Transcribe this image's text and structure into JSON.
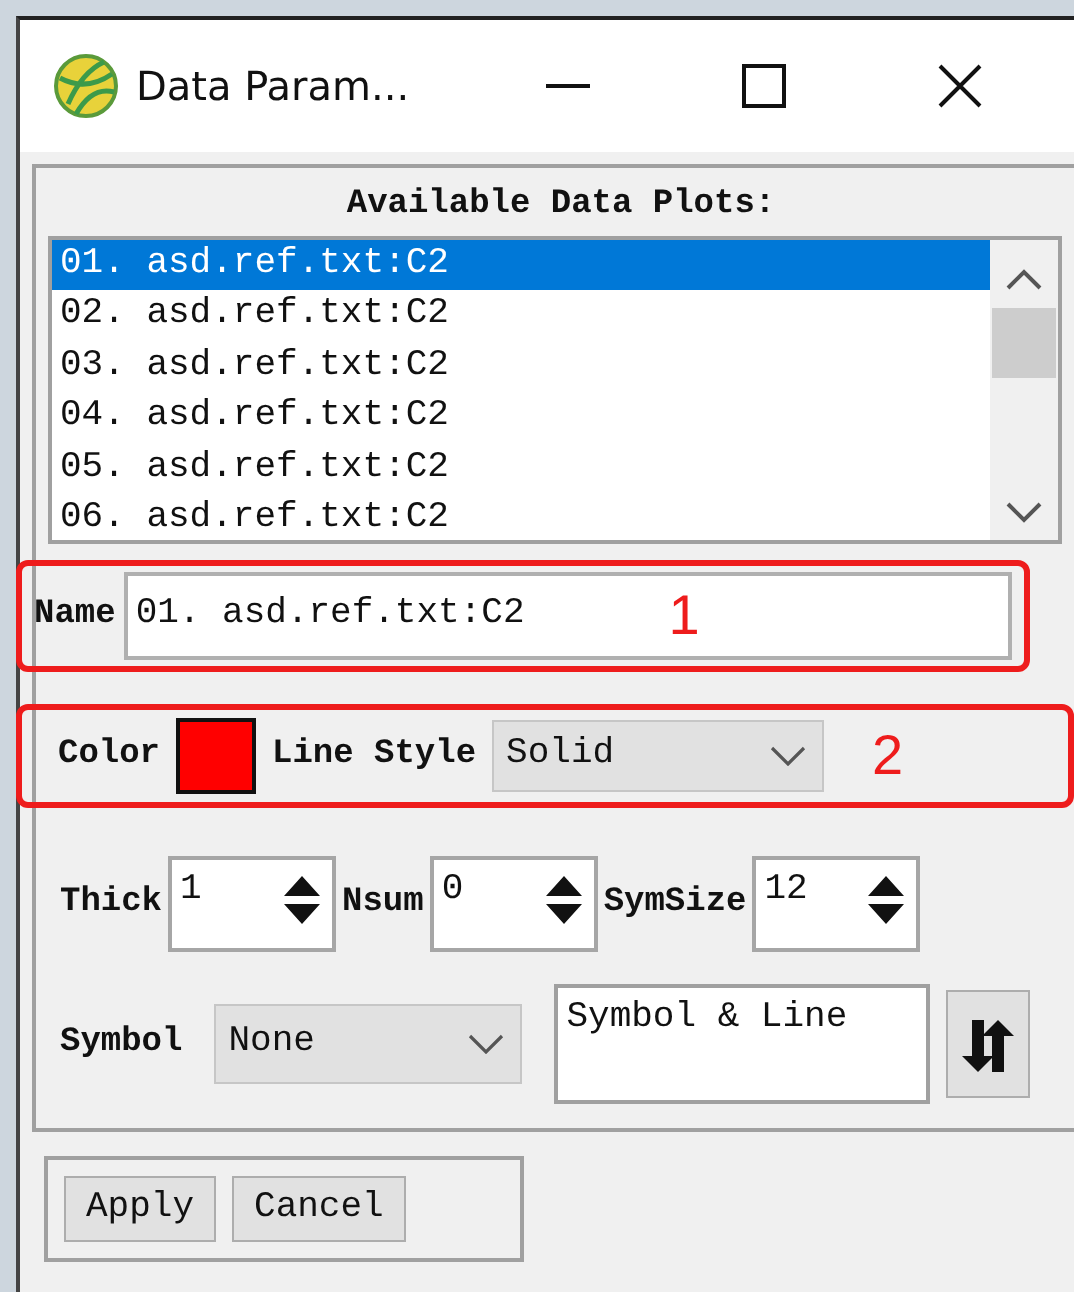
{
  "window": {
    "title": "Data Param..."
  },
  "plots": {
    "label": "Available Data Plots:",
    "items": [
      {
        "text": "01. asd.ref.txt:C2",
        "selected": true
      },
      {
        "text": "02. asd.ref.txt:C2",
        "selected": false
      },
      {
        "text": "03. asd.ref.txt:C2",
        "selected": false
      },
      {
        "text": "04. asd.ref.txt:C2",
        "selected": false
      },
      {
        "text": "05. asd.ref.txt:C2",
        "selected": false
      },
      {
        "text": "06. asd.ref.txt:C2",
        "selected": false
      }
    ]
  },
  "name_field": {
    "label": "Name",
    "value": "01. asd.ref.txt:C2",
    "annotation": "1"
  },
  "style_row": {
    "annotation": "2",
    "color_label": "Color",
    "color": "#ff0000",
    "line_style_label": "Line Style",
    "line_style": "Solid"
  },
  "spinners": [
    {
      "label": "Thick",
      "value": "1"
    },
    {
      "label": "Nsum",
      "value": "0"
    },
    {
      "label": "SymSize",
      "value": "12"
    }
  ],
  "symbol": {
    "label": "Symbol",
    "value": "None"
  },
  "plot_mode": {
    "value": "Symbol & Line"
  },
  "buttons": [
    "Apply",
    "Cancel"
  ]
}
